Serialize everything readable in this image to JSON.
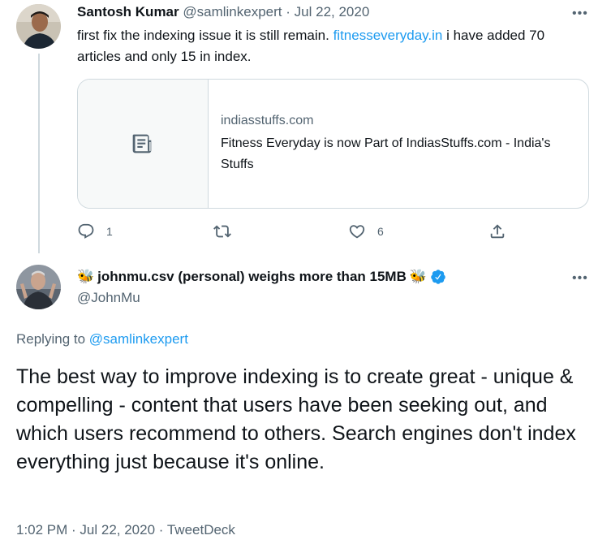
{
  "reply_tweet": {
    "author_name": "Santosh Kumar",
    "handle": "@samlinkexpert",
    "separator": "·",
    "date": "Jul 22, 2020",
    "more_label": "•••",
    "text_before_link": "first fix the indexing issue it is still remain. ",
    "link_text": "fitnesseveryday.in",
    "text_after_link": " i have added 70 articles and only 15 in index.",
    "card": {
      "domain": "indiasstuffs.com",
      "title": "Fitness Everyday is now Part of IndiasStuffs.com - India's Stuffs"
    },
    "actions": {
      "reply_count": "1",
      "retweet_count": "",
      "like_count": "6",
      "share_count": ""
    }
  },
  "main_tweet": {
    "name_prefix_emoji": "🐝",
    "author_name": "johnmu.csv (personal) weighs more than 15MB",
    "name_suffix_emoji": "🐝",
    "handle": "@JohnMu",
    "more_label": "•••",
    "replying_to_label": "Replying to",
    "replying_to_handle": "@samlinkexpert",
    "text": "The best way to improve indexing is to create great - unique & compelling - content that users have been seeking out, and which users recommend to others. Search engines don't index everything just because it's online.",
    "timestamp": "1:02 PM · Jul 22, 2020 · TweetDeck"
  },
  "colors": {
    "accent": "#1d9bf0",
    "muted_text": "#536471",
    "border": "#cfd9de",
    "verified": "#1d9bf0"
  }
}
